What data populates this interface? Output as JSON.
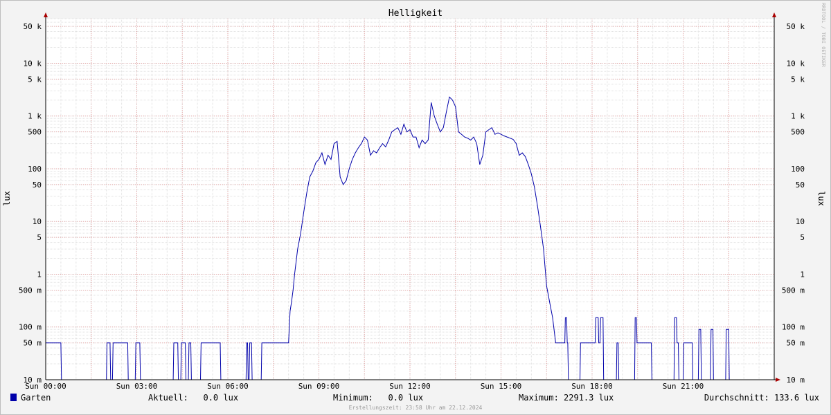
{
  "chart_data": {
    "type": "line",
    "title": "Helligkeit",
    "ylabel": "lux",
    "scale": "log",
    "ylim": [
      0.01,
      70000
    ],
    "xlim_hours": [
      0,
      24
    ],
    "x_ticks": [
      "Sun 00:00",
      "Sun 03:00",
      "Sun 06:00",
      "Sun 09:00",
      "Sun 12:00",
      "Sun 15:00",
      "Sun 18:00",
      "Sun 21:00"
    ],
    "y_ticks": [
      {
        "v": 50000,
        "label": "50 k"
      },
      {
        "v": 10000,
        "label": "10 k"
      },
      {
        "v": 5000,
        "label": "5 k"
      },
      {
        "v": 1000,
        "label": "1 k"
      },
      {
        "v": 500,
        "label": "500"
      },
      {
        "v": 100,
        "label": "100"
      },
      {
        "v": 50,
        "label": "50"
      },
      {
        "v": 10,
        "label": "10"
      },
      {
        "v": 5,
        "label": "5"
      },
      {
        "v": 1,
        "label": "1"
      },
      {
        "v": 0.5,
        "label": "500 m"
      },
      {
        "v": 0.1,
        "label": "100 m"
      },
      {
        "v": 0.05,
        "label": "50 m"
      },
      {
        "v": 0.01,
        "label": "10 m"
      }
    ],
    "series": [
      {
        "name": "Garten",
        "color": "#0000aa",
        "points": [
          [
            0.0,
            0.05
          ],
          [
            0.5,
            0.05
          ],
          [
            0.52,
            0.01
          ],
          [
            2.0,
            0.01
          ],
          [
            2.02,
            0.05
          ],
          [
            2.12,
            0.05
          ],
          [
            2.14,
            0.01
          ],
          [
            2.2,
            0.01
          ],
          [
            2.22,
            0.05
          ],
          [
            2.7,
            0.05
          ],
          [
            2.72,
            0.01
          ],
          [
            2.95,
            0.01
          ],
          [
            2.97,
            0.05
          ],
          [
            3.1,
            0.05
          ],
          [
            3.12,
            0.01
          ],
          [
            4.2,
            0.01
          ],
          [
            4.22,
            0.05
          ],
          [
            4.35,
            0.05
          ],
          [
            4.37,
            0.01
          ],
          [
            4.45,
            0.01
          ],
          [
            4.47,
            0.05
          ],
          [
            4.6,
            0.05
          ],
          [
            4.62,
            0.01
          ],
          [
            4.7,
            0.01
          ],
          [
            4.72,
            0.05
          ],
          [
            4.78,
            0.05
          ],
          [
            4.8,
            0.01
          ],
          [
            5.1,
            0.01
          ],
          [
            5.12,
            0.05
          ],
          [
            5.75,
            0.05
          ],
          [
            5.77,
            0.01
          ],
          [
            6.6,
            0.01
          ],
          [
            6.62,
            0.05
          ],
          [
            6.65,
            0.05
          ],
          [
            6.67,
            0.01
          ],
          [
            6.7,
            0.01
          ],
          [
            6.72,
            0.05
          ],
          [
            6.78,
            0.05
          ],
          [
            6.8,
            0.01
          ],
          [
            7.1,
            0.01
          ],
          [
            7.12,
            0.05
          ],
          [
            7.95,
            0.05
          ],
          [
            8.0,
            0.05
          ],
          [
            8.05,
            0.2
          ],
          [
            8.1,
            0.3
          ],
          [
            8.15,
            0.5
          ],
          [
            8.2,
            1
          ],
          [
            8.3,
            3
          ],
          [
            8.4,
            6
          ],
          [
            8.5,
            15
          ],
          [
            8.6,
            35
          ],
          [
            8.7,
            70
          ],
          [
            8.8,
            90
          ],
          [
            8.9,
            130
          ],
          [
            9.0,
            150
          ],
          [
            9.1,
            200
          ],
          [
            9.2,
            120
          ],
          [
            9.3,
            180
          ],
          [
            9.4,
            150
          ],
          [
            9.5,
            300
          ],
          [
            9.6,
            330
          ],
          [
            9.7,
            70
          ],
          [
            9.8,
            50
          ],
          [
            9.9,
            60
          ],
          [
            10.0,
            100
          ],
          [
            10.1,
            150
          ],
          [
            10.2,
            200
          ],
          [
            10.3,
            250
          ],
          [
            10.4,
            300
          ],
          [
            10.5,
            400
          ],
          [
            10.6,
            350
          ],
          [
            10.7,
            180
          ],
          [
            10.8,
            220
          ],
          [
            10.9,
            200
          ],
          [
            11.0,
            250
          ],
          [
            11.1,
            300
          ],
          [
            11.2,
            260
          ],
          [
            11.3,
            350
          ],
          [
            11.4,
            500
          ],
          [
            11.5,
            550
          ],
          [
            11.6,
            600
          ],
          [
            11.7,
            450
          ],
          [
            11.8,
            700
          ],
          [
            11.9,
            500
          ],
          [
            12.0,
            550
          ],
          [
            12.1,
            400
          ],
          [
            12.2,
            400
          ],
          [
            12.3,
            250
          ],
          [
            12.4,
            350
          ],
          [
            12.5,
            300
          ],
          [
            12.6,
            350
          ],
          [
            12.7,
            1800
          ],
          [
            12.8,
            1000
          ],
          [
            12.9,
            700
          ],
          [
            13.0,
            500
          ],
          [
            13.1,
            600
          ],
          [
            13.2,
            1200
          ],
          [
            13.3,
            2291
          ],
          [
            13.4,
            2000
          ],
          [
            13.5,
            1500
          ],
          [
            13.6,
            500
          ],
          [
            13.7,
            450
          ],
          [
            13.8,
            400
          ],
          [
            13.9,
            380
          ],
          [
            14.0,
            350
          ],
          [
            14.1,
            400
          ],
          [
            14.2,
            300
          ],
          [
            14.3,
            120
          ],
          [
            14.4,
            180
          ],
          [
            14.5,
            500
          ],
          [
            14.6,
            550
          ],
          [
            14.7,
            600
          ],
          [
            14.8,
            450
          ],
          [
            14.9,
            480
          ],
          [
            15.0,
            450
          ],
          [
            15.1,
            420
          ],
          [
            15.2,
            400
          ],
          [
            15.3,
            380
          ],
          [
            15.4,
            360
          ],
          [
            15.5,
            300
          ],
          [
            15.6,
            180
          ],
          [
            15.7,
            200
          ],
          [
            15.8,
            170
          ],
          [
            15.9,
            120
          ],
          [
            16.0,
            80
          ],
          [
            16.1,
            45
          ],
          [
            16.2,
            20
          ],
          [
            16.3,
            8
          ],
          [
            16.4,
            3
          ],
          [
            16.5,
            0.6
          ],
          [
            16.6,
            0.3
          ],
          [
            16.7,
            0.15
          ],
          [
            16.8,
            0.05
          ],
          [
            17.1,
            0.05
          ],
          [
            17.12,
            0.15
          ],
          [
            17.16,
            0.15
          ],
          [
            17.18,
            0.05
          ],
          [
            17.2,
            0.05
          ],
          [
            17.22,
            0.01
          ],
          [
            17.6,
            0.01
          ],
          [
            17.62,
            0.05
          ],
          [
            18.1,
            0.05
          ],
          [
            18.12,
            0.15
          ],
          [
            18.2,
            0.15
          ],
          [
            18.22,
            0.05
          ],
          [
            18.26,
            0.05
          ],
          [
            18.28,
            0.15
          ],
          [
            18.36,
            0.15
          ],
          [
            18.38,
            0.01
          ],
          [
            18.8,
            0.01
          ],
          [
            18.82,
            0.05
          ],
          [
            18.86,
            0.05
          ],
          [
            18.88,
            0.01
          ],
          [
            19.4,
            0.01
          ],
          [
            19.42,
            0.15
          ],
          [
            19.46,
            0.15
          ],
          [
            19.48,
            0.05
          ],
          [
            19.95,
            0.05
          ],
          [
            19.97,
            0.01
          ],
          [
            20.7,
            0.01
          ],
          [
            20.72,
            0.15
          ],
          [
            20.78,
            0.15
          ],
          [
            20.8,
            0.05
          ],
          [
            20.84,
            0.05
          ],
          [
            20.86,
            0.01
          ],
          [
            21.0,
            0.01
          ],
          [
            21.02,
            0.05
          ],
          [
            21.3,
            0.05
          ],
          [
            21.32,
            0.01
          ],
          [
            21.5,
            0.01
          ],
          [
            21.52,
            0.09
          ],
          [
            21.58,
            0.09
          ],
          [
            21.6,
            0.01
          ],
          [
            21.9,
            0.01
          ],
          [
            21.92,
            0.09
          ],
          [
            21.98,
            0.09
          ],
          [
            22.0,
            0.01
          ],
          [
            22.4,
            0.01
          ],
          [
            22.42,
            0.09
          ],
          [
            22.5,
            0.09
          ],
          [
            22.52,
            0.01
          ],
          [
            24.0,
            0.01
          ]
        ]
      }
    ]
  },
  "watermark": "RRDTOOL / TOBI OETIKER",
  "legend": {
    "series_name": "Garten",
    "swatch_color": "#0000aa",
    "aktuell": "Aktuell:   0.0 lux",
    "minimum": "Minimum:   0.0 lux",
    "maximum": "Maximum: 2291.3 lux",
    "durchschnitt": "Durchschnitt: 133.6 lux"
  },
  "footer": "Erstellungszeit: 23:58 Uhr am 22.12.2024"
}
